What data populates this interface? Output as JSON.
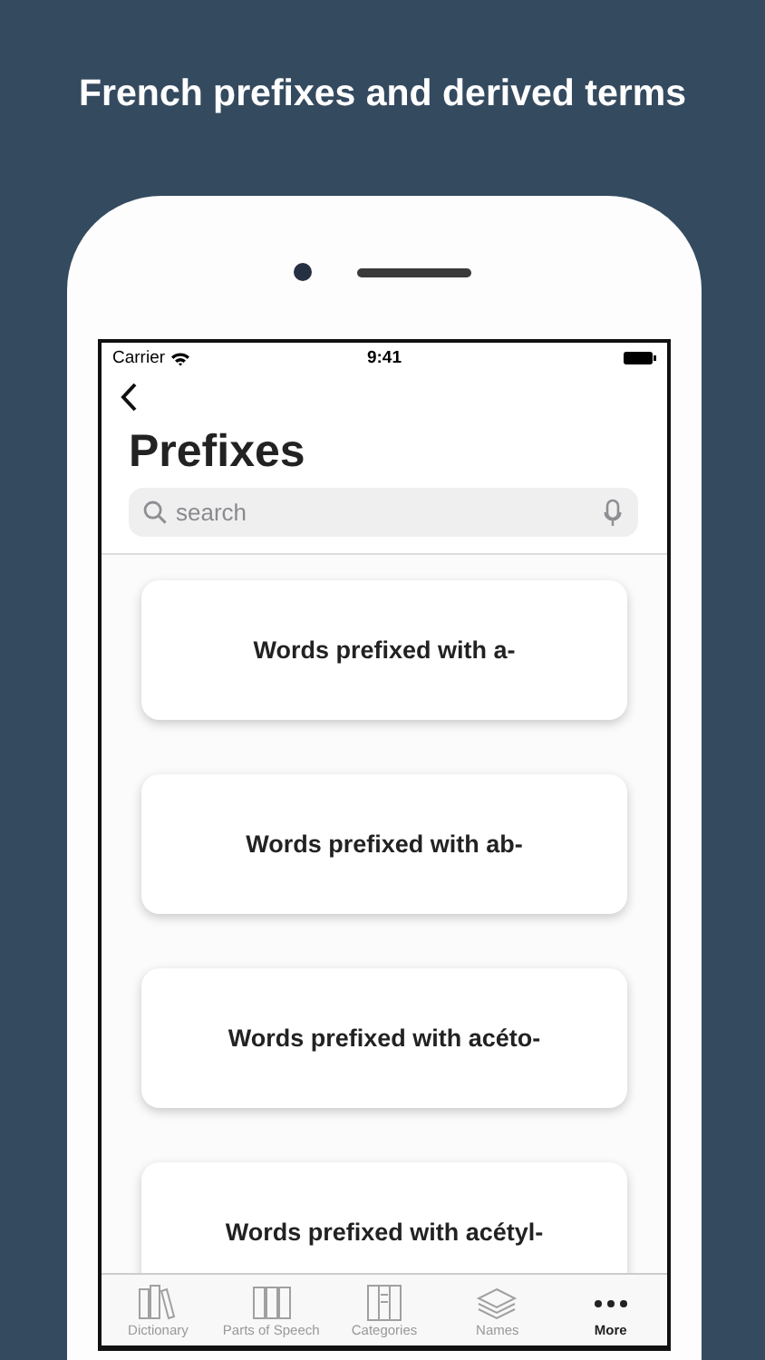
{
  "headline": "French prefixes and derived terms",
  "status_bar": {
    "carrier": "Carrier",
    "time": "9:41"
  },
  "title": "Prefixes",
  "search": {
    "placeholder": "search"
  },
  "cards": [
    {
      "label": "Words prefixed with a-"
    },
    {
      "label": "Words prefixed with ab-"
    },
    {
      "label": "Words prefixed with acéto-"
    },
    {
      "label": "Words prefixed with acétyl-"
    }
  ],
  "tabs": [
    {
      "label": "Dictionary",
      "kind": "books",
      "selected": false
    },
    {
      "label": "Parts of Speech",
      "kind": "binders",
      "selected": false
    },
    {
      "label": "Categories",
      "kind": "cabinet",
      "selected": false
    },
    {
      "label": "Names",
      "kind": "stack",
      "selected": false
    },
    {
      "label": "More",
      "kind": "dots",
      "selected": true
    }
  ]
}
